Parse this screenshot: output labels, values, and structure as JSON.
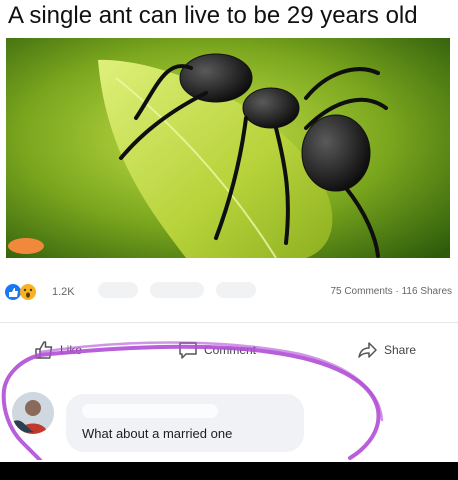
{
  "caption": {
    "text": "A single ant can live to be 29 years old"
  },
  "post": {
    "reactions": {
      "count": "1.2K",
      "icons": [
        "like-icon",
        "wow-icon"
      ]
    },
    "comments_count": "75 Comments",
    "separator": "·",
    "shares_count": "116 Shares"
  },
  "actions": {
    "like_label": "Like",
    "comment_label": "Comment",
    "share_label": "Share"
  },
  "comment": {
    "text": "What about a married one"
  },
  "colors": {
    "like_blue": "#1877f2",
    "wow_yellow": "#f7b125",
    "scribble_purple": "#b04ed6",
    "bubble_gray": "#f0f2f5"
  }
}
